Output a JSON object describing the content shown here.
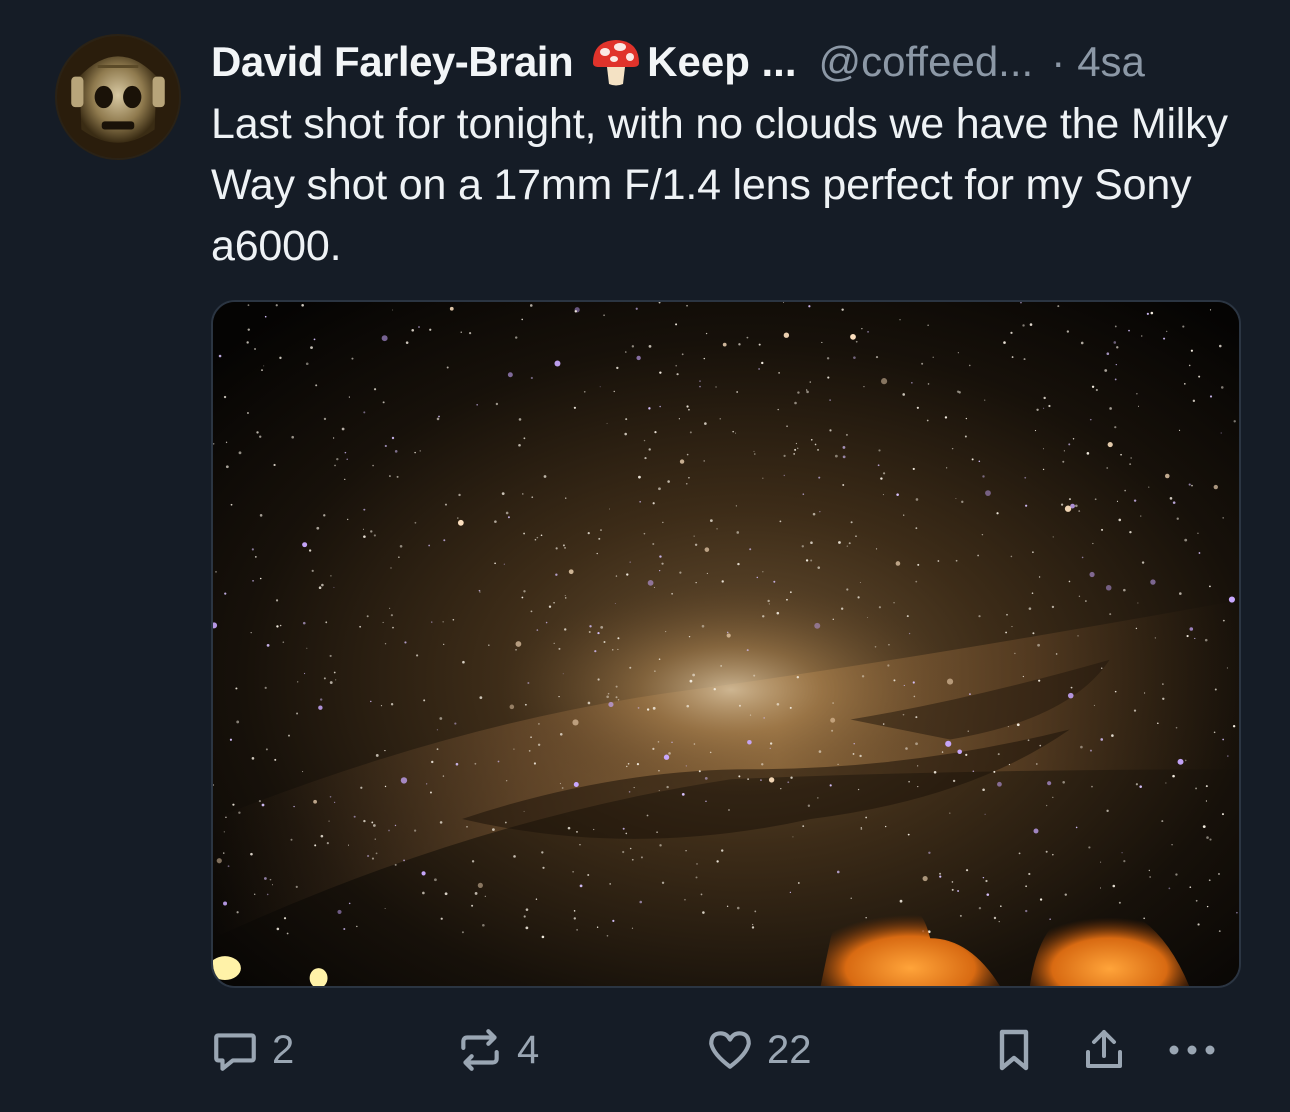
{
  "post": {
    "author": {
      "display_name": "David Farley-Brain",
      "name_emoji": "🍄",
      "name_tail": "Keep ...",
      "handle": "@coffeed...",
      "separator": "·",
      "time": "4sa",
      "avatar_icon": "cyberman-avatar"
    },
    "text": "Last shot for tonight, with no clouds we have the Milky Way shot on a 17mm F/1.4 lens perfect for my Sony a6000.",
    "media": {
      "type": "image",
      "subject_icon": "milky-way-photo"
    },
    "actions": {
      "reply": {
        "icon": "reply-icon",
        "count": "2"
      },
      "repost": {
        "icon": "repost-icon",
        "count": "4"
      },
      "like": {
        "icon": "heart-icon",
        "count": "22"
      },
      "bookmark": {
        "icon": "bookmark-icon"
      },
      "share": {
        "icon": "share-icon"
      },
      "more": {
        "icon": "more-icon"
      }
    },
    "colors": {
      "background": "#151c26",
      "text_primary": "#eef2f5",
      "text_secondary": "#8c98a6",
      "icon": "#9aa6b3"
    }
  }
}
